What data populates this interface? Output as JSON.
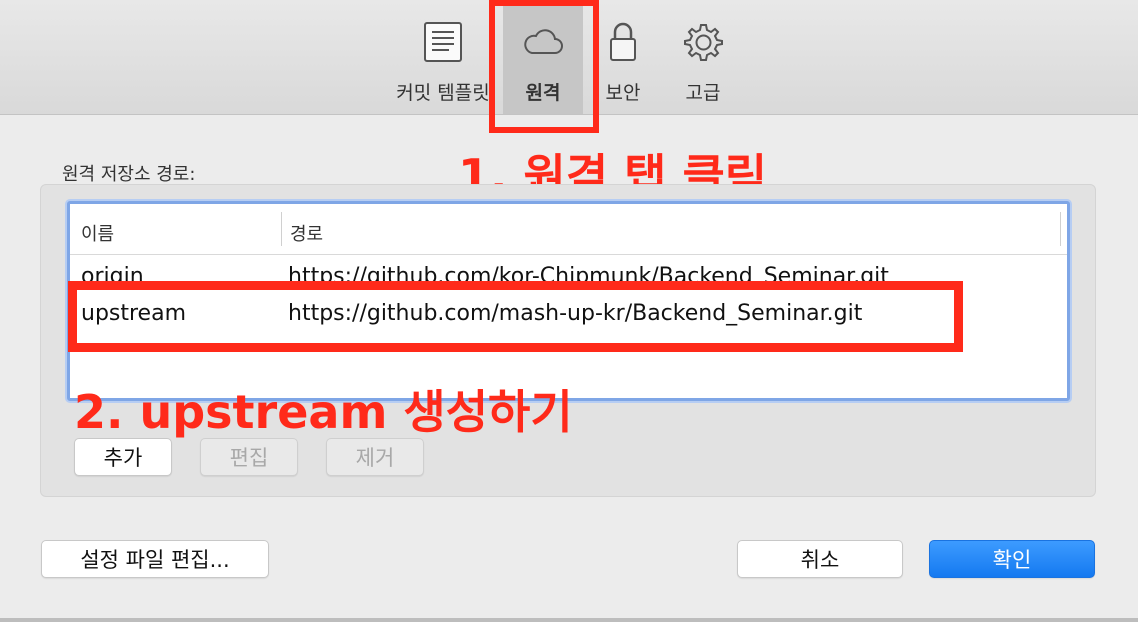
{
  "tabs": [
    {
      "label": "커밋 템플릿",
      "icon": "document-lines-icon"
    },
    {
      "label": "원격",
      "icon": "cloud-icon"
    },
    {
      "label": "보안",
      "icon": "lock-icon"
    },
    {
      "label": "고급",
      "icon": "gear-icon"
    }
  ],
  "section_label": "원격 저장소 경로:",
  "table": {
    "headers": [
      "이름",
      "경로"
    ],
    "rows": [
      {
        "name": "origin",
        "path": "https://github.com/kor-Chipmunk/Backend_Seminar.git"
      },
      {
        "name": "upstream",
        "path": "https://github.com/mash-up-kr/Backend_Seminar.git"
      }
    ]
  },
  "buttons": {
    "add": "추가",
    "edit": "편집",
    "remove": "제거",
    "edit_config": "설정 파일 편집...",
    "cancel": "취소",
    "ok": "확인"
  },
  "annotations": {
    "step1": "1. 원격 탭 클릭",
    "step2": "2. upstream 생성하기"
  },
  "colors": {
    "annotation": "#ff2a1a",
    "accent": "#1479f0",
    "selection_outline": "#7fa6e6"
  }
}
